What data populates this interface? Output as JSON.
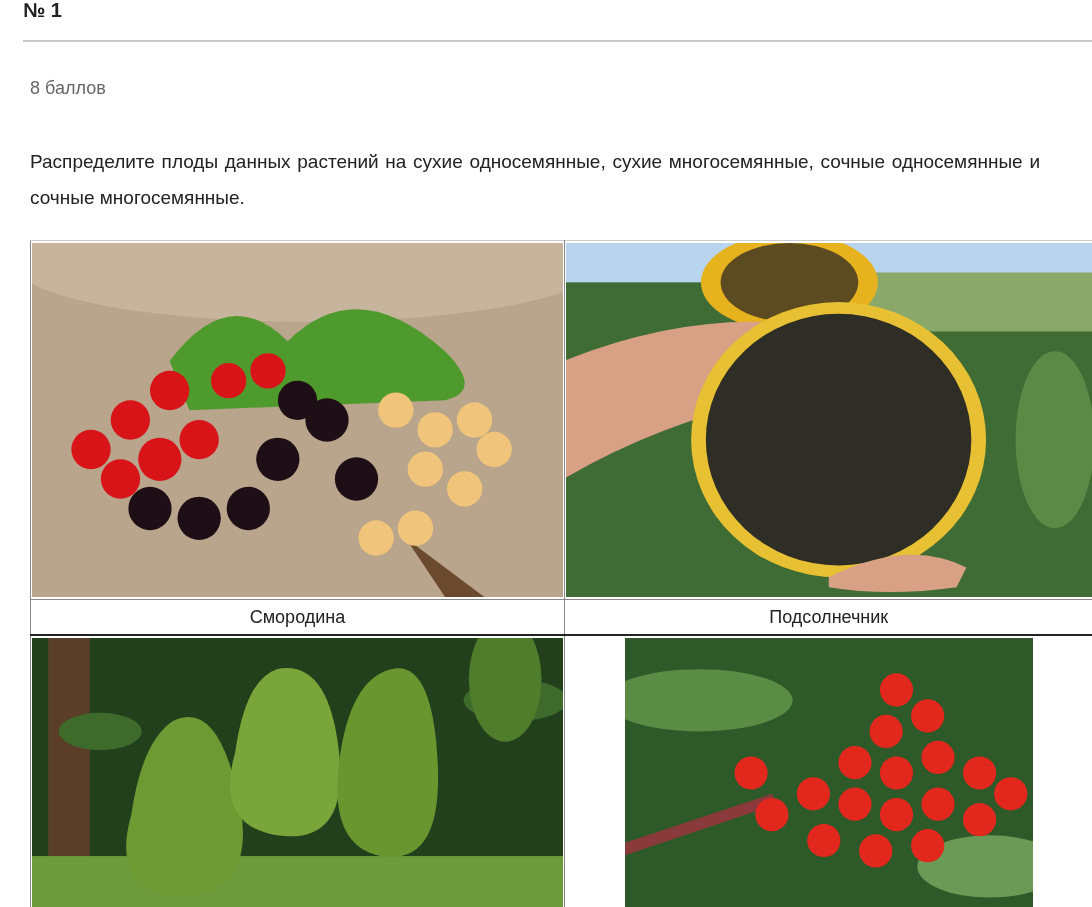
{
  "heading": "№ 1",
  "points": "8 баллов",
  "task": "Распределите плоды данных растений на сухие односемянные, сухие многосемянные, сочные односемянные и сочные многосемянные.",
  "table": {
    "rows": [
      {
        "kind": "images"
      },
      {
        "kind": "captions",
        "cells": [
          {
            "text": "Смородина"
          },
          {
            "text": "Подсолнечник"
          }
        ]
      },
      {
        "kind": "images"
      }
    ]
  }
}
